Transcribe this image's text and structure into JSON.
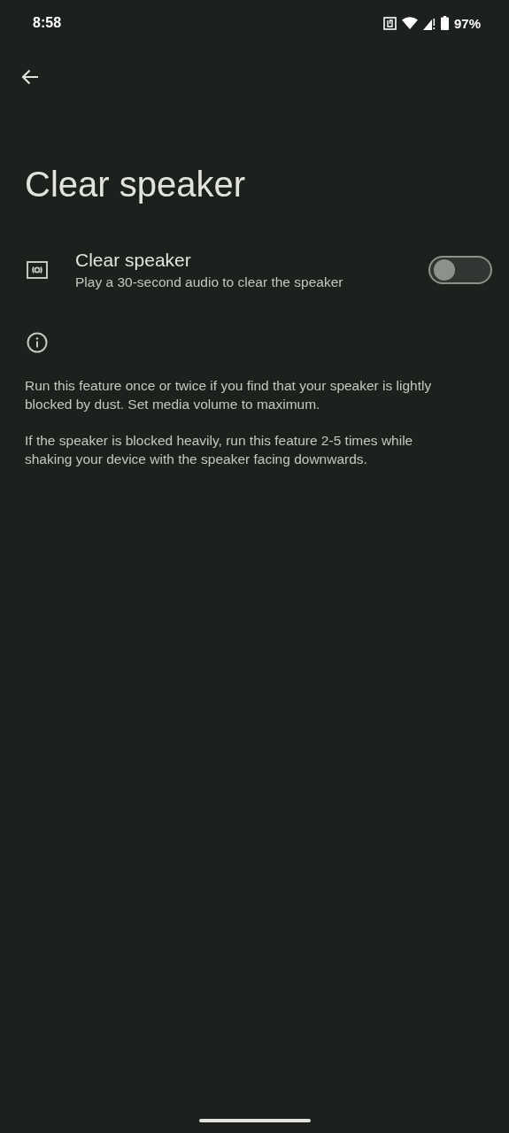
{
  "status_bar": {
    "time": "8:58",
    "battery": "97%"
  },
  "title": "Clear speaker",
  "setting": {
    "title": "Clear speaker",
    "subtitle": "Play a 30-second audio to clear the speaker",
    "on": false
  },
  "info": [
    "Run this feature once or twice if you find that your speaker is lightly blocked by dust. Set media volume to maximum.",
    "If the speaker is blocked heavily, run this feature 2-5 times while shaking your device with the speaker facing downwards."
  ]
}
